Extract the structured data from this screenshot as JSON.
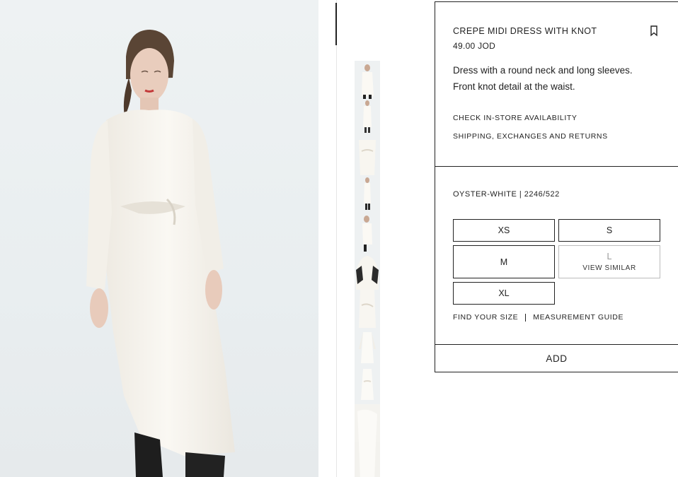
{
  "product": {
    "title": "CREPE MIDI DRESS WITH KNOT",
    "price": "49.00 JOD",
    "description_line1": "Dress with a round neck and long sleeves.",
    "description_line2": "Front knot detail at the waist.",
    "check_store": "CHECK IN-STORE AVAILABILITY",
    "shipping": "SHIPPING, EXCHANGES AND RETURNS",
    "color_ref": "OYSTER-WHITE | 2246/522"
  },
  "sizes": [
    {
      "label": "XS",
      "available": true
    },
    {
      "label": "S",
      "available": true
    },
    {
      "label": "M",
      "available": true
    },
    {
      "label": "L",
      "available": false,
      "note": "VIEW SIMILAR"
    },
    {
      "label": "XL",
      "available": true
    }
  ],
  "size_links": {
    "find_size": "FIND YOUR SIZE",
    "guide": "MEASUREMENT GUIDE"
  },
  "add_label": "ADD",
  "icons": {
    "bookmark": "bookmark-icon"
  },
  "colors": {
    "border": "#222222",
    "background": "#ffffff",
    "photo_bg": "#e9eef0",
    "dress": "#f7f5ef",
    "unavailable": "#bbbbbb"
  }
}
